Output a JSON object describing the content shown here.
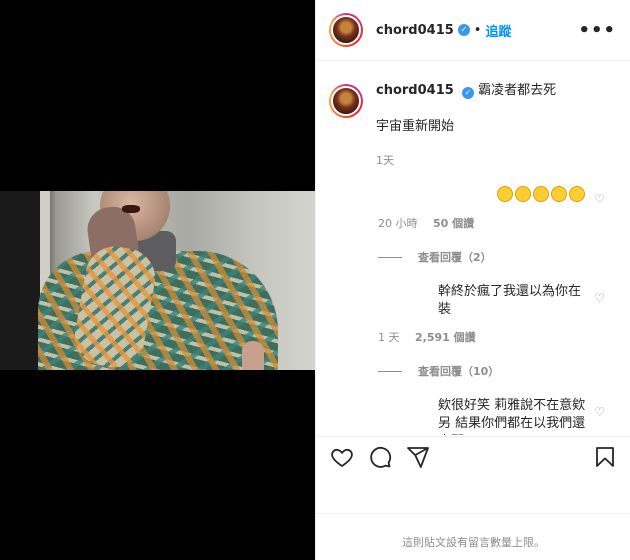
{
  "header": {
    "username": "chord0415",
    "dot": "•",
    "follow_label": "追蹤",
    "more_label": "•••"
  },
  "caption": {
    "username": "chord0415",
    "text_line1": "霸凌者都去死",
    "text_line2": "宇宙重新開始",
    "time": "1天"
  },
  "comments": [
    {
      "text": "",
      "time": "20 小時",
      "likes": "50 個讚",
      "replies": "查看回覆（2）"
    },
    {
      "text": "幹終於瘋了我還以為你在裝",
      "time": "1 天",
      "likes": "2,591 個讚",
      "replies": "查看回覆（10）"
    },
    {
      "text": "欸很好笑 莉雅說不在意欸另 結果你們都在以我們還真那"
    }
  ],
  "footer": {
    "limit_text": "這則貼文設有留言數量上限。"
  },
  "colors": {
    "follow": "#0095f6",
    "verified": "#3897f0",
    "muted": "#8e8e8e"
  }
}
